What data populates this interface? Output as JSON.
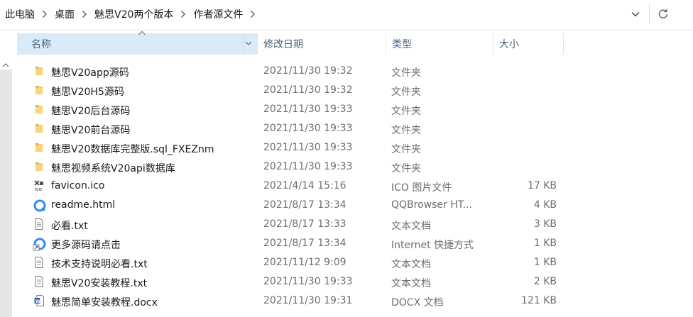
{
  "breadcrumb": [
    "此电脑",
    "桌面",
    "魅思V20两个版本",
    "作者源文件"
  ],
  "columns": {
    "name": "名称",
    "date": "修改日期",
    "type": "类型",
    "size": "大小"
  },
  "files": [
    {
      "icon": "folder-icon",
      "name": "魅思V20app源码",
      "date": "2021/11/30 19:32",
      "type": "文件夹",
      "size": ""
    },
    {
      "icon": "folder-icon",
      "name": "魅思V20H5源码",
      "date": "2021/11/30 19:32",
      "type": "文件夹",
      "size": ""
    },
    {
      "icon": "folder-icon",
      "name": "魅思V20后台源码",
      "date": "2021/11/30 19:33",
      "type": "文件夹",
      "size": ""
    },
    {
      "icon": "folder-icon",
      "name": "魅思V20前台源码",
      "date": "2021/11/30 19:33",
      "type": "文件夹",
      "size": ""
    },
    {
      "icon": "folder-icon",
      "name": "魅思V20数据库完整版.sql_FXEZnm",
      "date": "2021/11/30 19:33",
      "type": "文件夹",
      "size": ""
    },
    {
      "icon": "folder-icon",
      "name": "魅思视频系统V20api数据库",
      "date": "2021/11/30 19:33",
      "type": "文件夹",
      "size": ""
    },
    {
      "icon": "ico-file-icon",
      "name": "favicon.ico",
      "date": "2021/4/14 15:16",
      "type": "ICO 图片文件",
      "size": "17 KB"
    },
    {
      "icon": "browser-html-icon",
      "name": "readme.html",
      "date": "2021/8/17 13:34",
      "type": "QQBrowser HT...",
      "size": "4 KB"
    },
    {
      "icon": "text-file-icon",
      "name": "必看.txt",
      "date": "2021/8/17 13:33",
      "type": "文本文档",
      "size": "3 KB"
    },
    {
      "icon": "internet-shortcut-icon",
      "name": "更多源码请点击",
      "date": "2021/8/17 13:34",
      "type": "Internet 快捷方式",
      "size": "1 KB"
    },
    {
      "icon": "text-file-icon",
      "name": "技术支持说明必看.txt",
      "date": "2021/11/12 9:09",
      "type": "文本文档",
      "size": "1 KB"
    },
    {
      "icon": "text-file-icon",
      "name": "魅思V20安装教程.txt",
      "date": "2021/11/30 19:33",
      "type": "文本文档",
      "size": "2 KB"
    },
    {
      "icon": "word-docx-icon",
      "name": "魅思简单安装教程.docx",
      "date": "2021/11/30 19:31",
      "type": "DOCX 文档",
      "size": "121 KB"
    }
  ],
  "colors": {
    "header_selected": "#d9ebf9",
    "folder": "#f2c55c",
    "browser_blue": "#2d8cf0",
    "word_blue": "#2b579a"
  }
}
